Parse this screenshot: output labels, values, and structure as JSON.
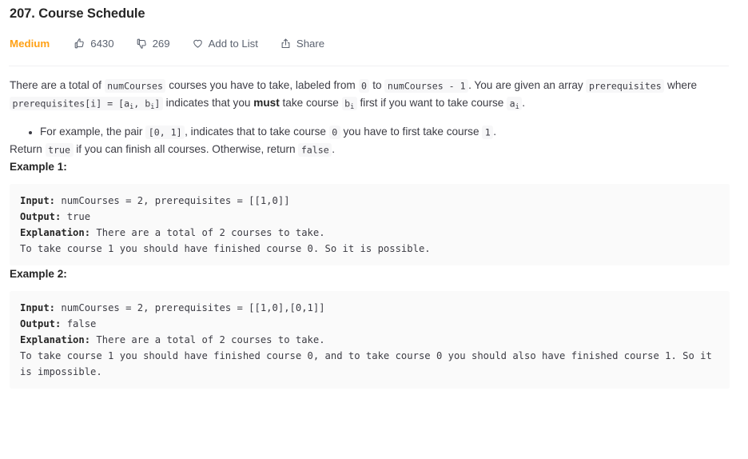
{
  "problem": {
    "title": "207. Course Schedule",
    "difficulty": "Medium",
    "likes": "6430",
    "dislikes": "269",
    "add_to_list_label": "Add to List",
    "share_label": "Share"
  },
  "icons": {
    "thumbs_up": "thumbs-up-icon",
    "thumbs_down": "thumbs-down-icon",
    "heart": "heart-icon",
    "share": "share-icon"
  },
  "description": {
    "p1_a": "There are a total of ",
    "p1_code1": "numCourses",
    "p1_b": " courses you have to take, labeled from ",
    "p1_code2": "0",
    "p1_c": " to ",
    "p1_code3": "numCourses - 1",
    "p1_d": ". You are given an array ",
    "p1_code4": "prerequisites",
    "p1_e": " where ",
    "p1_code5_pre": "prerequisites[i] = [a",
    "p1_code5_sub1": "i",
    "p1_code5_mid": ", b",
    "p1_code5_sub2": "i",
    "p1_code5_post": "]",
    "p1_f": " indicates that you ",
    "p1_must": "must",
    "p1_g": " take course ",
    "p1_code6_pre": "b",
    "p1_code6_sub": "i",
    "p1_h": " first if you want to take course ",
    "p1_code7_pre": "a",
    "p1_code7_sub": "i",
    "p1_i": ".",
    "bullet_a": "For example, the pair ",
    "bullet_code1": "[0, 1]",
    "bullet_b": ", indicates that to take course ",
    "bullet_code2": "0",
    "bullet_c": " you have to first take course ",
    "bullet_code3": "1",
    "bullet_d": ".",
    "p2_a": "Return ",
    "p2_code1": "true",
    "p2_b": " if you can finish all courses. Otherwise, return ",
    "p2_code2": "false",
    "p2_c": "."
  },
  "examples": [
    {
      "label": "Example 1:",
      "input_label": "Input:",
      "input_value": " numCourses = 2, prerequisites = [[1,0]]",
      "output_label": "Output:",
      "output_value": " true",
      "explanation_label": "Explanation:",
      "explanation_value": " There are a total of 2 courses to take.\nTo take course 1 you should have finished course 0. So it is possible."
    },
    {
      "label": "Example 2:",
      "input_label": "Input:",
      "input_value": " numCourses = 2, prerequisites = [[1,0],[0,1]]",
      "output_label": "Output:",
      "output_value": " false",
      "explanation_label": "Explanation:",
      "explanation_value": " There are a total of 2 courses to take.\nTo take course 1 you should have finished course 0, and to take course 0 you should also have finished course 1. So it is impossible."
    }
  ],
  "colors": {
    "difficulty_medium": "#ffa116",
    "code_block_bg": "#fafafa",
    "inline_code_bg": "#f7f7f8",
    "text": "#3c3c44",
    "divider": "#f0f1f2"
  }
}
